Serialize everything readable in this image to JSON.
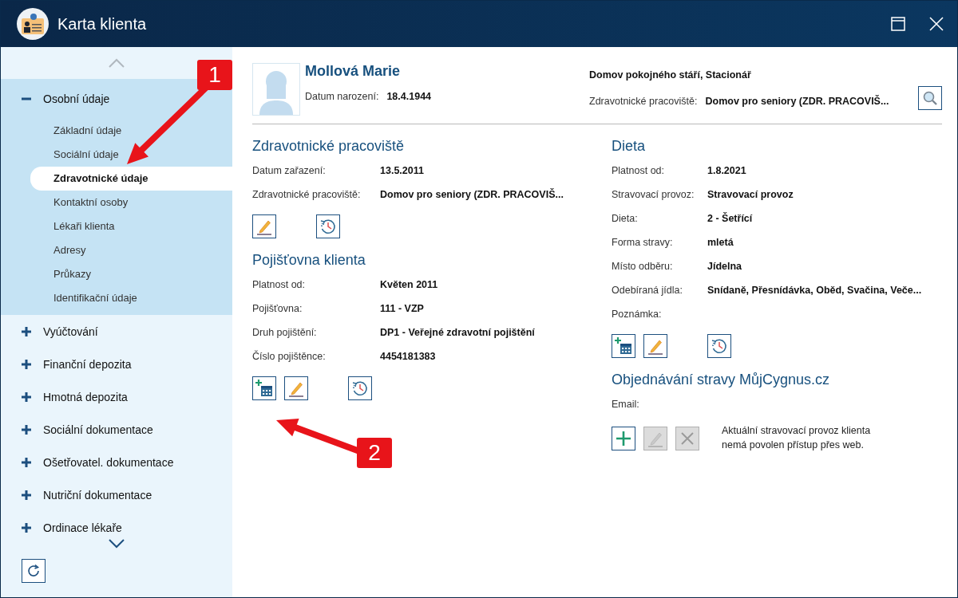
{
  "window": {
    "title": "Karta klienta"
  },
  "sidebar": {
    "items": [
      {
        "label": "Osobní údaje",
        "expanded": true,
        "children": [
          {
            "label": "Základní údaje",
            "selected": false
          },
          {
            "label": "Sociální údaje",
            "selected": false
          },
          {
            "label": "Zdravotnické údaje",
            "selected": true
          },
          {
            "label": "Kontaktní osoby",
            "selected": false
          },
          {
            "label": "Lékaři klienta",
            "selected": false
          },
          {
            "label": "Adresy",
            "selected": false
          },
          {
            "label": "Průkazy",
            "selected": false
          },
          {
            "label": "Identifikační údaje",
            "selected": false
          }
        ]
      },
      {
        "label": "Vyúčtování",
        "expanded": false
      },
      {
        "label": "Finanční depozita",
        "expanded": false
      },
      {
        "label": "Hmotná depozita",
        "expanded": false
      },
      {
        "label": "Sociální dokumentace",
        "expanded": false
      },
      {
        "label": "Ošetřovatel. dokumentace",
        "expanded": false
      },
      {
        "label": "Nutriční dokumentace",
        "expanded": false
      },
      {
        "label": "Ordinace lékaře",
        "expanded": false
      }
    ]
  },
  "client": {
    "name": "Mollová Marie",
    "birth_label": "Datum narození:",
    "birth_date": "18.4.1944",
    "facility": "Domov pokojného stáří, Stacionář",
    "workplace_label": "Zdravotnické pracoviště:",
    "workplace": "Domov pro seniory (ZDR. PRACOVIŠ..."
  },
  "columns": [
    [
      {
        "title": "Zdravotnické pracoviště",
        "fields": [
          {
            "label": "Datum zařazení:",
            "value": "13.5.2011"
          },
          {
            "label": "Zdravotnické pracoviště:",
            "value": "Domov pro seniory (ZDR. PRACOVIŠ..."
          }
        ],
        "buttons": [
          {
            "kind": "edit",
            "disabled": false
          },
          {
            "kind": "history",
            "disabled": false
          }
        ]
      },
      {
        "title": "Pojišťovna klienta",
        "fields": [
          {
            "label": "Platnost od:",
            "value": "Květen 2011"
          },
          {
            "label": "Pojišťovna:",
            "value": "111 - VZP"
          },
          {
            "label": "Druh pojištění:",
            "value": "DP1 - Veřejné zdravotní pojištění"
          },
          {
            "label": "Číslo pojištěnce:",
            "value": "4454181383"
          }
        ],
        "buttons": [
          {
            "kind": "add",
            "disabled": false
          },
          {
            "kind": "edit",
            "disabled": false
          },
          {
            "kind": "history",
            "disabled": false
          }
        ]
      }
    ],
    [
      {
        "title": "Dieta",
        "fields": [
          {
            "label": "Platnost od:",
            "value": "1.8.2021"
          },
          {
            "label": "Stravovací provoz:",
            "value": "Stravovací provoz"
          },
          {
            "label": "Dieta:",
            "value": "2 - Šetřící"
          },
          {
            "label": "Forma stravy:",
            "value": "mletá"
          },
          {
            "label": "Místo odběru:",
            "value": "Jídelna"
          },
          {
            "label": "Odebíraná jídla:",
            "value": "Snídaně, Přesnídávka, Oběd, Svačina, Veče..."
          },
          {
            "label": "Poznámka:"
          }
        ],
        "buttons": [
          {
            "kind": "add",
            "disabled": false
          },
          {
            "kind": "edit",
            "disabled": false
          },
          {
            "kind": "history",
            "disabled": false
          }
        ]
      },
      {
        "title": "Objednávání stravy MůjCygnus.cz",
        "fields": [
          {
            "label": "Email:"
          }
        ],
        "buttons": [
          {
            "kind": "plus",
            "disabled": false
          },
          {
            "kind": "edit",
            "disabled": true
          },
          {
            "kind": "delete",
            "disabled": true
          }
        ],
        "note": "Aktuální stravovací provoz klienta nemá povolen přístup přes web."
      }
    ]
  ],
  "annotations": [
    {
      "label": "1"
    },
    {
      "label": "2"
    }
  ]
}
